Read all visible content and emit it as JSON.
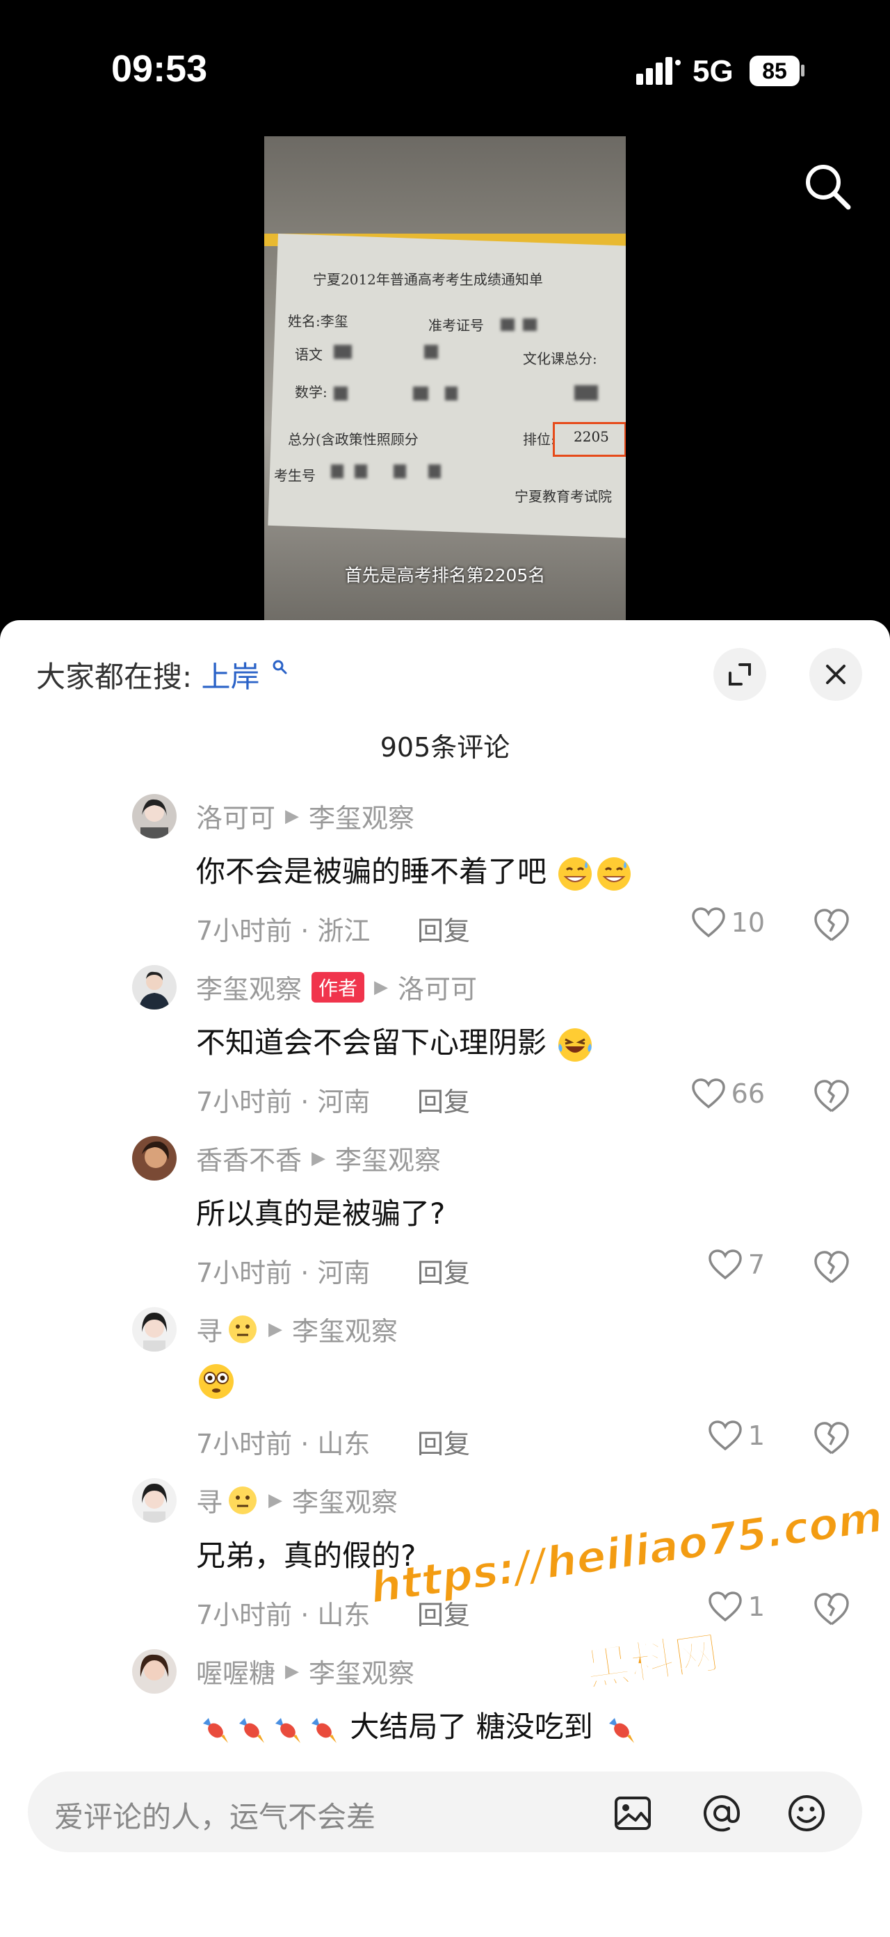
{
  "status_bar": {
    "time": "09:53",
    "network": "5G",
    "battery": "85"
  },
  "video": {
    "subtitle": "首先是高考排名第2205名",
    "doc_title": "宁夏2012年普通高考考生成绩通知单",
    "doc_name": "姓名:李玺",
    "doc_exam_id": "准考证号",
    "doc_chinese": "语文",
    "doc_culture_total": "文化课总分:",
    "doc_math": "数学:",
    "doc_total": "总分(含政策性照顾分",
    "doc_rank_label": "排位:",
    "doc_rank_value": "2205",
    "doc_student": "考生号",
    "doc_issuer": "宁夏教育考试院"
  },
  "sheet": {
    "hot_search_label": "大家都在搜:",
    "hot_search_term": "上岸",
    "comment_count": "905条评论"
  },
  "comments": [
    {
      "user": "洛可可",
      "reply_to": "李玺观察",
      "text": "你不会是被骗的睡不着了吧",
      "emojis": [
        "grin-sweat",
        "grin-sweat"
      ],
      "time_location": "7小时前 · 浙江",
      "reply_label": "回复",
      "likes": "10",
      "is_author": false
    },
    {
      "user": "李玺观察",
      "badge": "作者",
      "reply_to": "洛可可",
      "text": "不知道会不会留下心理阴影",
      "emojis": [
        "laugh-cry"
      ],
      "time_location": "7小时前 · 河南",
      "reply_label": "回复",
      "likes": "66",
      "is_author": true
    },
    {
      "user": "香香不香",
      "reply_to": "李玺观察",
      "text": "所以真的是被骗了?",
      "emojis": [],
      "time_location": "7小时前 · 河南",
      "reply_label": "回复",
      "likes": "7",
      "is_author": false
    },
    {
      "user": "寻",
      "reply_to": "李玺观察",
      "text": "",
      "emojis": [
        "flushed"
      ],
      "time_location": "7小时前 · 山东",
      "reply_label": "回复",
      "likes": "1",
      "is_author": false
    },
    {
      "user": "寻",
      "reply_to": "李玺观察",
      "text": "兄弟，真的假的?",
      "emojis": [],
      "time_location": "7小时前 · 山东",
      "reply_label": "回复",
      "likes": "1",
      "is_author": false
    },
    {
      "user": "喔喔糖",
      "reply_to": "李玺观察",
      "text_prefix": "大结局了 糖没吃到",
      "emojis": [
        "candy",
        "candy",
        "candy",
        "candy"
      ],
      "time_location": "",
      "reply_label": "",
      "likes": "",
      "is_author": false
    }
  ],
  "watermark": {
    "url": "https://heiliao75.com",
    "name": "黑料网"
  },
  "input_bar": {
    "placeholder": "爱评论的人，运气不会差"
  },
  "icons": {
    "search": "search-icon",
    "expand": "expand-icon",
    "close": "close-icon",
    "heart": "heart-icon",
    "dislike": "broken-heart-icon",
    "image": "image-icon",
    "at": "at-icon",
    "emoji": "emoji-icon"
  },
  "colors": {
    "link_blue": "#2a62c7",
    "author_badge": "#f0344c",
    "watermark_orange": "#f39c12"
  }
}
